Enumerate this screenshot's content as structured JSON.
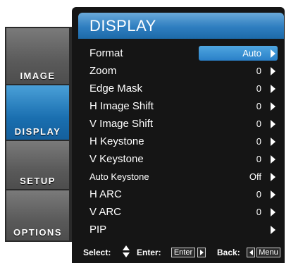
{
  "title": "DISPLAY",
  "sidebar": {
    "tabs": [
      {
        "label": "IMAGE",
        "active": false
      },
      {
        "label": "DISPLAY",
        "active": true
      },
      {
        "label": "SETUP",
        "active": false
      },
      {
        "label": "OPTIONS",
        "active": false
      }
    ]
  },
  "menu": {
    "items": [
      {
        "label": "Format",
        "value": "Auto",
        "selected": true
      },
      {
        "label": "Zoom",
        "value": "0"
      },
      {
        "label": "Edge Mask",
        "value": "0"
      },
      {
        "label": "H Image Shift",
        "value": "0"
      },
      {
        "label": "V Image Shift",
        "value": "0"
      },
      {
        "label": "H Keystone",
        "value": "0"
      },
      {
        "label": "V Keystone",
        "value": "0"
      },
      {
        "label": "Auto Keystone",
        "value": "Off"
      },
      {
        "label": "H ARC",
        "value": "0"
      },
      {
        "label": "V ARC",
        "value": "0"
      },
      {
        "label": "PIP",
        "value": ""
      }
    ]
  },
  "footer": {
    "select_label": "Select:",
    "enter_label": "Enter:",
    "enter_key": "Enter",
    "back_label": "Back:",
    "menu_key": "Menu"
  },
  "colors": {
    "accent": "#2a80c8",
    "panel": "#151515",
    "sidebar_inactive": "#5a5a5a"
  }
}
